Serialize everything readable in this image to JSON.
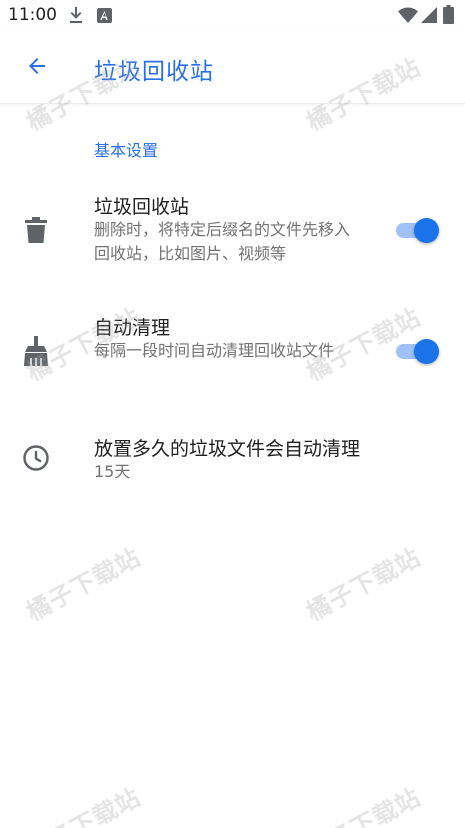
{
  "status_bar": {
    "time": "11:00",
    "icons": [
      "download-icon",
      "a-notification-icon",
      "wifi-icon",
      "cell-signal-icon",
      "battery-icon"
    ]
  },
  "app_bar": {
    "back_icon": "arrow-back-icon",
    "title": "垃圾回收站"
  },
  "section": {
    "header": "基本设置"
  },
  "settings": {
    "recycle_bin": {
      "icon": "trash-icon",
      "title": "垃圾回收站",
      "summary": "删除时，将特定后缀名的文件先移入回收站，比如图片、视频等",
      "enabled": true
    },
    "auto_clean": {
      "icon": "broom-icon",
      "title": "自动清理",
      "summary": "每隔一段时间自动清理回收站文件",
      "enabled": true
    },
    "retention": {
      "icon": "clock-icon",
      "title": "放置多久的垃圾文件会自动清理",
      "value": "15天"
    }
  },
  "watermark": "橘子下载站",
  "colors": {
    "accent": "#2a6fe8",
    "switch_thumb": "#1a73e8",
    "switch_track": "#9fc1f7",
    "summary_text": "#737373"
  }
}
